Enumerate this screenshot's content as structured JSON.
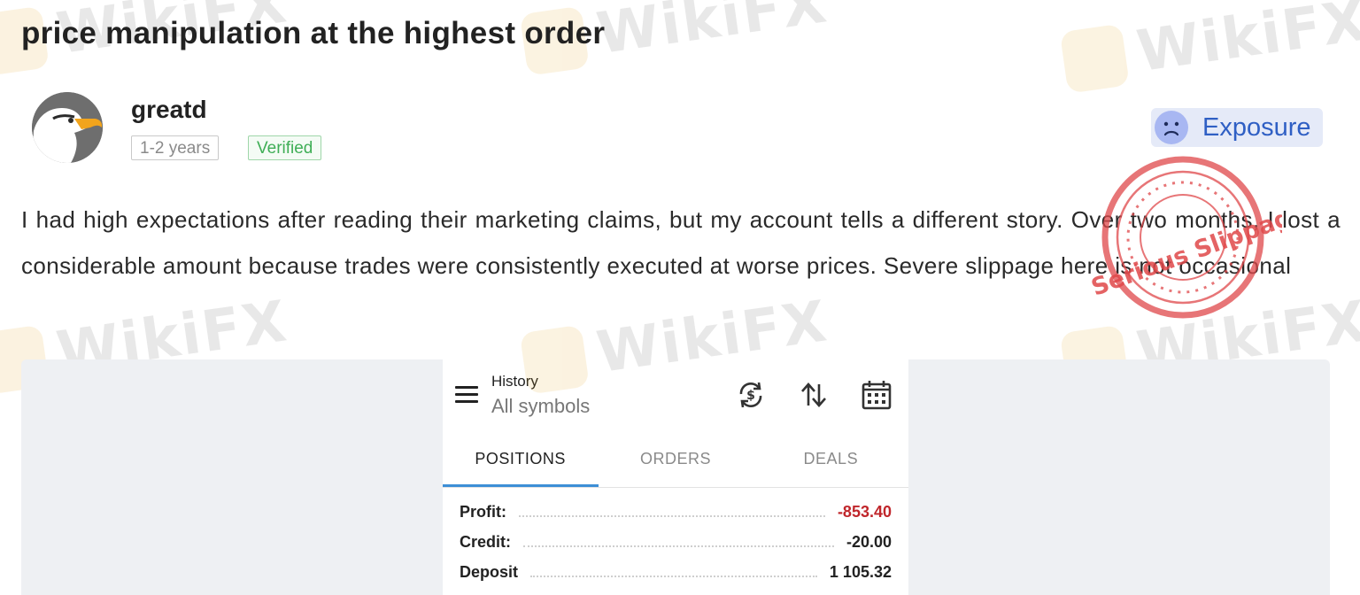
{
  "review": {
    "title": "price manipulation at the highest order",
    "username": "greatd",
    "tenure_tag": "1-2 years",
    "verified_tag": "Verified",
    "exposure_label": "Exposure",
    "stamp_text": "Serious Slippage",
    "body": "I had high expectations after reading their marketing claims, but my account tells a different story. Over two months, I lost a considerable amount because trades were consistently executed at worse prices. Severe slippage here is not occasional"
  },
  "watermark": {
    "text": "WikiFX"
  },
  "screenshot": {
    "header_title": "History",
    "header_subtitle": "All symbols",
    "tabs": [
      {
        "label": "POSITIONS",
        "active": true
      },
      {
        "label": "ORDERS",
        "active": false
      },
      {
        "label": "DEALS",
        "active": false
      }
    ],
    "rows": [
      {
        "label": "Profit:",
        "value": "-853.40",
        "negative": true
      },
      {
        "label": "Credit:",
        "value": "-20.00",
        "negative": false
      },
      {
        "label": "Deposit",
        "value": "1 105.32",
        "negative": false
      }
    ],
    "icons": [
      "menu-icon",
      "currency-exchange-icon",
      "sort-icon",
      "calendar-icon"
    ]
  },
  "colors": {
    "verified": "#3fae56",
    "exposure_text": "#2f5fc4",
    "exposure_bg": "#e5eaf8",
    "stamp": "#e0484a",
    "negative_value": "#c0262b",
    "tab_underline": "#3d8fd6"
  }
}
